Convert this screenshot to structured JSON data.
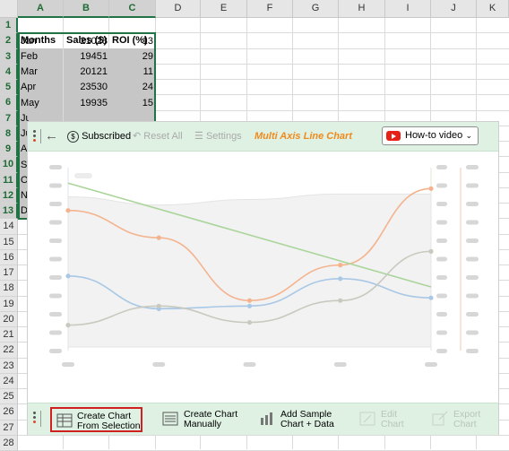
{
  "columns": [
    "A",
    "B",
    "C",
    "D",
    "E",
    "F",
    "G",
    "H",
    "I",
    "J",
    "K"
  ],
  "rows": [
    "1",
    "2",
    "3",
    "4",
    "5",
    "6",
    "7",
    "8",
    "9",
    "10",
    "11",
    "12",
    "13",
    "14",
    "15",
    "16",
    "17",
    "18",
    "19",
    "20",
    "21",
    "22",
    "23",
    "24",
    "25",
    "26",
    "27",
    "28"
  ],
  "table": {
    "headers": [
      "Months",
      "Sales ($)",
      "ROI (%)"
    ],
    "rows": [
      [
        "Jan",
        "21028",
        "13"
      ],
      [
        "Feb",
        "19451",
        "29"
      ],
      [
        "Mar",
        "20121",
        "11"
      ],
      [
        "Apr",
        "23530",
        "24"
      ],
      [
        "May",
        "19935",
        "15"
      ]
    ],
    "partial_rows": [
      "Ju",
      "Ju",
      "Au",
      "Se",
      "Oc",
      "No",
      "De"
    ]
  },
  "toolbar": {
    "subscribed": "Subscribed",
    "reset_all": "Reset All",
    "settings": "Settings",
    "title": "Multi Axis Line Chart",
    "howto": "How-to video"
  },
  "bottom": {
    "create_selection": [
      "Create Chart",
      "From Selection"
    ],
    "create_manual": [
      "Create Chart",
      "Manually"
    ],
    "add_sample": [
      "Add Sample",
      "Chart + Data"
    ],
    "edit_chart": [
      "Edit",
      "Chart"
    ],
    "export_chart": [
      "Export",
      "Chart"
    ]
  },
  "colors": {
    "excel_green": "#217346",
    "panel_bg": "#dff1e3",
    "accent_orange": "#f08a1c",
    "series_orange": "#f4b38e",
    "series_green": "#a9d59a",
    "series_blue": "#a9c8e6",
    "series_gray": "#c9c9bf"
  },
  "chart_data": {
    "type": "line",
    "x": [
      1,
      2,
      3,
      4,
      5
    ],
    "series": [
      {
        "values": [
          80,
          70,
          47,
          60,
          88
        ]
      },
      {
        "values": [
          90,
          80,
          70,
          60,
          52
        ]
      },
      {
        "values": [
          56,
          44,
          45,
          55,
          48
        ]
      },
      {
        "values": [
          38,
          45,
          39,
          47,
          65
        ]
      }
    ],
    "area_band": [
      85,
      82,
      84,
      86,
      86
    ],
    "placeholders": true
  }
}
